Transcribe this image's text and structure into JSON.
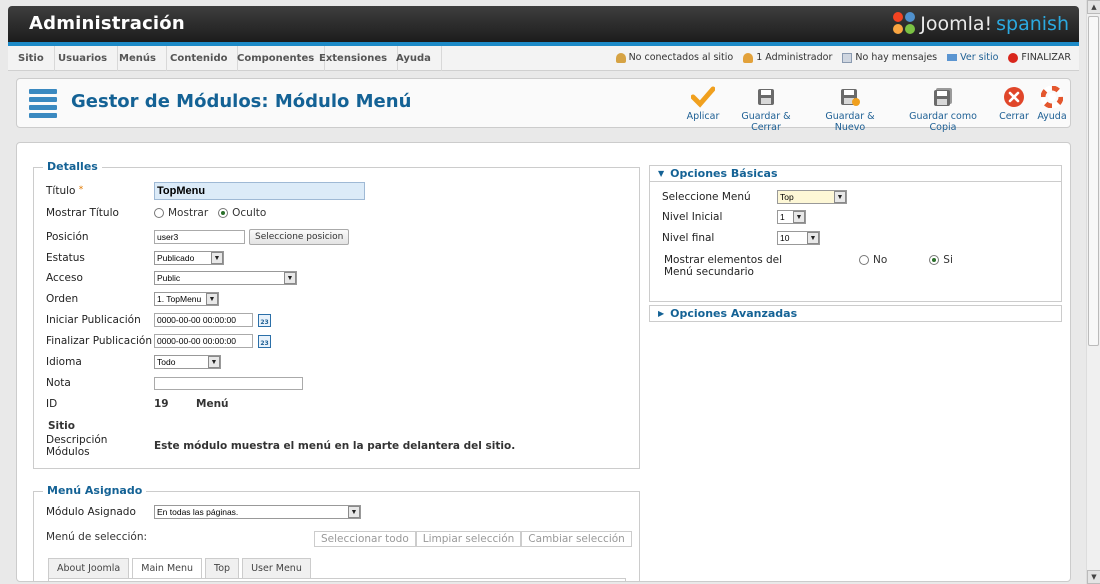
{
  "header": {
    "brand": "Administración",
    "logo_main": "Joomla!",
    "logo_sub": "spanish"
  },
  "menu": [
    "Sitio",
    "Usuarios",
    "Menús",
    "Contenido",
    "Componentes",
    "Extensiones",
    "Ayuda"
  ],
  "status": {
    "users_online": "No conectados al sitio",
    "admins": "1 Administrador",
    "messages": "No hay mensajes",
    "view_site": "Ver sitio",
    "logout": "FINALIZAR"
  },
  "toolbar": {
    "title": "Gestor de Módulos: Módulo Menú",
    "buttons": {
      "apply": "Aplicar",
      "save_close": "Guardar & Cerrar",
      "save_new": "Guardar & Nuevo",
      "save_copy": "Guardar como Copia",
      "close": "Cerrar",
      "help": "Ayuda"
    }
  },
  "details": {
    "legend": "Detalles",
    "title_label": "Título",
    "title_required": "*",
    "title_value": "TopMenu",
    "show_title_label": "Mostrar Título",
    "show_option": "Mostrar",
    "hide_option": "Oculto",
    "position_label": "Posición",
    "position_value": "user3",
    "position_button": "Seleccione posicion",
    "status_label": "Estatus",
    "status_value": "Publicado",
    "access_label": "Acceso",
    "access_value": "Public",
    "order_label": "Orden",
    "order_value": "1. TopMenu",
    "publish_up_label": "Iniciar Publicación",
    "publish_up_value": "0000-00-00 00:00:00",
    "publish_down_label": "Finalizar Publicación",
    "publish_down_value": "0000-00-00 00:00:00",
    "language_label": "Idioma",
    "language_value": "Todo",
    "note_label": "Nota",
    "note_value": "",
    "id_label": "ID",
    "id_value": "19",
    "module_type": "Menú",
    "site_label": "Sitio",
    "desc_label": "Descripción Módulos",
    "desc_value": "Este módulo muestra el menú en la parte delantera del sitio.",
    "calendar_icon_text": "23"
  },
  "assignment": {
    "legend": "Menú Asignado",
    "assigned_label": "Módulo Asignado",
    "assigned_value": "En todas las páginas.",
    "selection_label": "Menú de selección:",
    "select_all": "Seleccionar todo",
    "clear_selection": "Limpiar selección",
    "toggle_selection": "Cambiar selección",
    "tabs": [
      "About Joomla",
      "Main Menu",
      "Top",
      "User Menu"
    ]
  },
  "basic": {
    "header": "Opciones Básicas",
    "menu_label": "Seleccione Menú",
    "menu_value": "Top",
    "start_label": "Nivel Inicial",
    "start_value": "1",
    "end_label": "Nivel final",
    "end_value": "10",
    "sub_label": "Mostrar elementos del Menú secundario",
    "no": "No",
    "yes": "Si"
  },
  "advanced": {
    "header": "Opciones Avanzadas"
  },
  "colors": {
    "title_blue": "#146295",
    "header_dark": "#2a2a2a",
    "accent_blue": "#1d8ac7"
  }
}
